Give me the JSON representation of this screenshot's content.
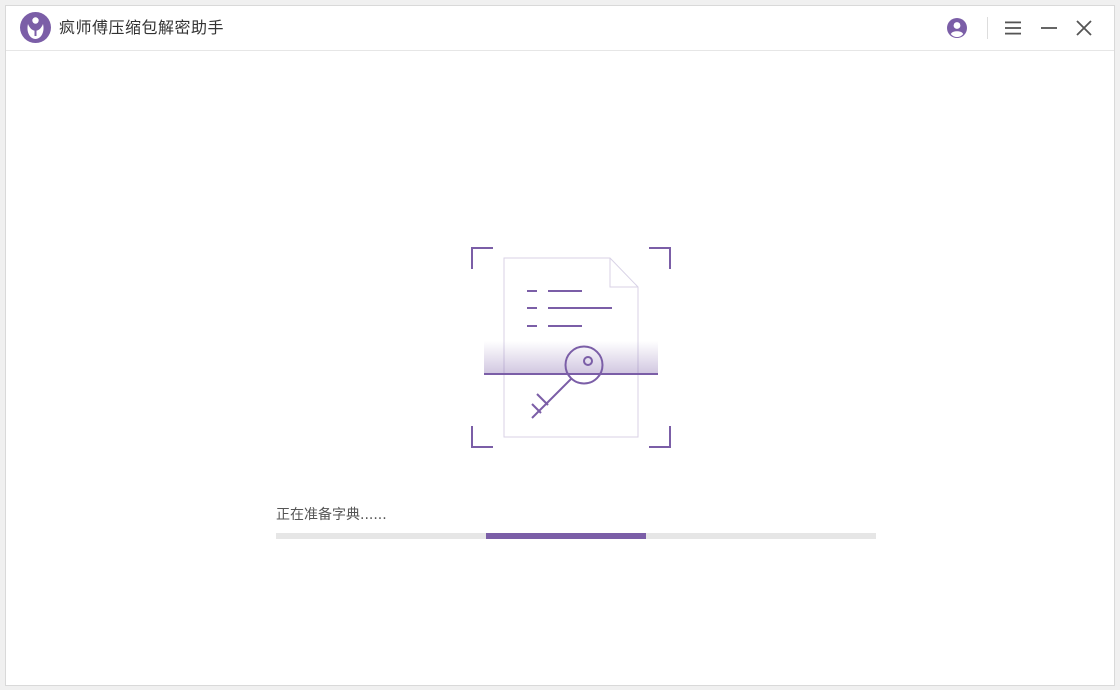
{
  "app": {
    "title": "疯师傅压缩包解密助手",
    "logo_icon": "app-logo-icon"
  },
  "titlebar": {
    "buttons": [
      {
        "name": "user-account-button",
        "icon": "user-icon"
      },
      {
        "name": "menu-button",
        "icon": "hamburger-menu-icon"
      },
      {
        "name": "minimize-button",
        "icon": "minimize-icon"
      },
      {
        "name": "close-button",
        "icon": "close-icon"
      }
    ]
  },
  "main": {
    "illustration_icon": "document-key-scan-icon",
    "status_text": "正在准备字典......",
    "progress": {
      "indeterminate": true,
      "segment_start": 0.35,
      "segment_end": 0.617
    }
  },
  "colors": {
    "accent": "#7b5ea7",
    "track": "#e6e6e6",
    "title_text": "#333333"
  }
}
